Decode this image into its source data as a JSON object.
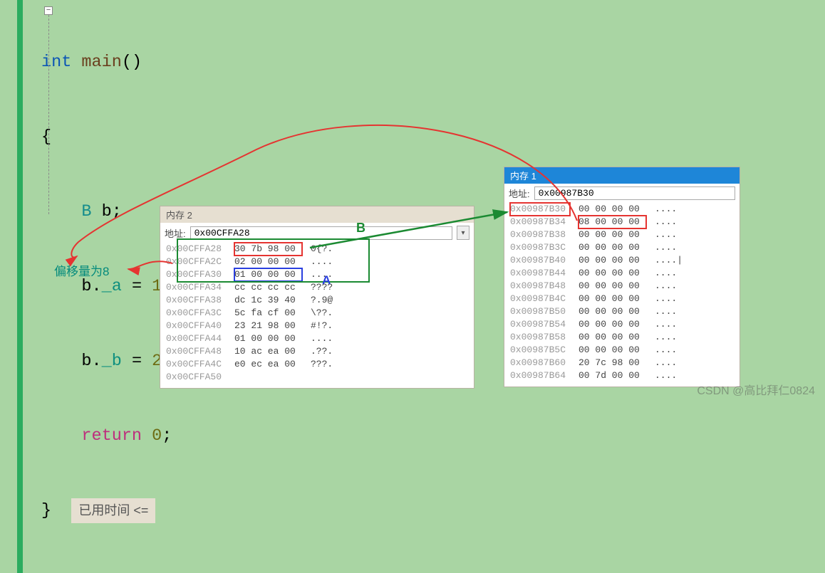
{
  "code": {
    "l1_kw": "int",
    "l1_fn": "main",
    "l1_rest": "()",
    "l2": "{",
    "l3_type": "B",
    "l3_rest": " b;",
    "l4_pre": "b.",
    "l4_mem": "_a",
    "l4_eq": " = ",
    "l4_num": "1",
    "l4_sc": ";",
    "l5_pre": "b.",
    "l5_mem": "_b",
    "l5_eq": " = ",
    "l5_num": "2",
    "l5_sc": ";",
    "l6_kw": "return",
    "l6_sp": " ",
    "l6_num": "0",
    "l6_sc": ";",
    "l7": "}",
    "elapsed": "已用时间 <="
  },
  "mem2": {
    "title": "内存 2",
    "addr_label": "地址:",
    "addr_value": "0x00CFFA28",
    "rows": [
      {
        "addr": "0x00CFFA28",
        "hex": "30 7b 98 00",
        "asc": "0{?."
      },
      {
        "addr": "0x00CFFA2C",
        "hex": "02 00 00 00",
        "asc": "...."
      },
      {
        "addr": "0x00CFFA30",
        "hex": "01 00 00 00",
        "asc": "...."
      },
      {
        "addr": "0x00CFFA34",
        "hex": "cc cc cc cc",
        "asc": "????"
      },
      {
        "addr": "0x00CFFA38",
        "hex": "dc 1c 39 40",
        "asc": "?.9@"
      },
      {
        "addr": "0x00CFFA3C",
        "hex": "5c fa cf 00",
        "asc": "\\??."
      },
      {
        "addr": "0x00CFFA40",
        "hex": "23 21 98 00",
        "asc": "#!?."
      },
      {
        "addr": "0x00CFFA44",
        "hex": "01 00 00 00",
        "asc": "...."
      },
      {
        "addr": "0x00CFFA48",
        "hex": "10 ac ea 00",
        "asc": ".??."
      },
      {
        "addr": "0x00CFFA4C",
        "hex": "e0 ec ea 00",
        "asc": "???."
      },
      {
        "addr": "0x00CFFA50",
        "hex": "",
        "asc": ""
      }
    ]
  },
  "mem1": {
    "title": "内存 1",
    "addr_label": "地址:",
    "addr_value": "0x00987B30",
    "rows": [
      {
        "addr": "0x00987B30",
        "hex": "00 00 00 00",
        "asc": "...."
      },
      {
        "addr": "0x00987B34",
        "hex": "08 00 00 00",
        "asc": "...."
      },
      {
        "addr": "0x00987B38",
        "hex": "00 00 00 00",
        "asc": "...."
      },
      {
        "addr": "0x00987B3C",
        "hex": "00 00 00 00",
        "asc": "...."
      },
      {
        "addr": "0x00987B40",
        "hex": "00 00 00 00",
        "asc": "....|"
      },
      {
        "addr": "0x00987B44",
        "hex": "00 00 00 00",
        "asc": "...."
      },
      {
        "addr": "0x00987B48",
        "hex": "00 00 00 00",
        "asc": "...."
      },
      {
        "addr": "0x00987B4C",
        "hex": "00 00 00 00",
        "asc": "...."
      },
      {
        "addr": "0x00987B50",
        "hex": "00 00 00 00",
        "asc": "...."
      },
      {
        "addr": "0x00987B54",
        "hex": "00 00 00 00",
        "asc": "...."
      },
      {
        "addr": "0x00987B58",
        "hex": "00 00 00 00",
        "asc": "...."
      },
      {
        "addr": "0x00987B5C",
        "hex": "00 00 00 00",
        "asc": "...."
      },
      {
        "addr": "0x00987B60",
        "hex": "20 7c 98 00",
        "asc": "...."
      },
      {
        "addr": "0x00987B64",
        "hex": "00 7d 00 00",
        "asc": "...."
      }
    ]
  },
  "annotations": {
    "B": "B",
    "A": "A",
    "offset": "偏移量为8"
  },
  "watermark": "CSDN @高比拜仁0824"
}
